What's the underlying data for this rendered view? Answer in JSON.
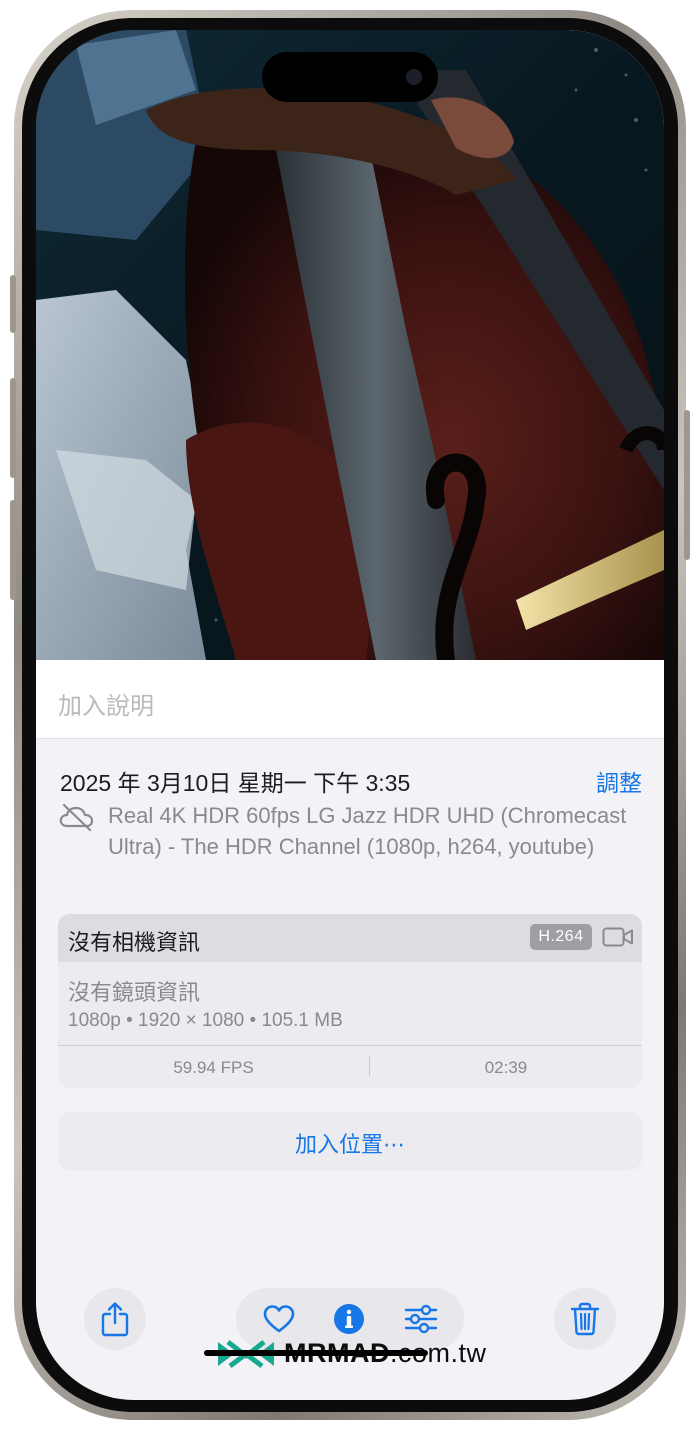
{
  "caption": {
    "placeholder": "加入說明"
  },
  "info": {
    "date": "2025 年 3月10日 星期一 下午 3:35",
    "adjust_label": "調整",
    "title": "Real 4K HDR 60fps LG Jazz HDR UHD (Chromecast Ultra) - The HDR Channel (1080p, h264, youtube)"
  },
  "camera_card": {
    "title": "沒有相機資訊",
    "codec": "H.264",
    "lens": "沒有鏡頭資訊",
    "specs": "1080p • 1920 × 1080 • 105.1 MB",
    "fps": "59.94 FPS",
    "duration": "02:39"
  },
  "location": {
    "label": "加入位置⋯"
  },
  "toolbar": {
    "icons": [
      "share-icon",
      "heart-icon",
      "info-icon",
      "adjust-icon",
      "trash-icon"
    ],
    "accent": "#1877e6"
  },
  "watermark": {
    "brand": "MRMAD",
    "domain": ".com.tw",
    "color": "#17a990"
  }
}
